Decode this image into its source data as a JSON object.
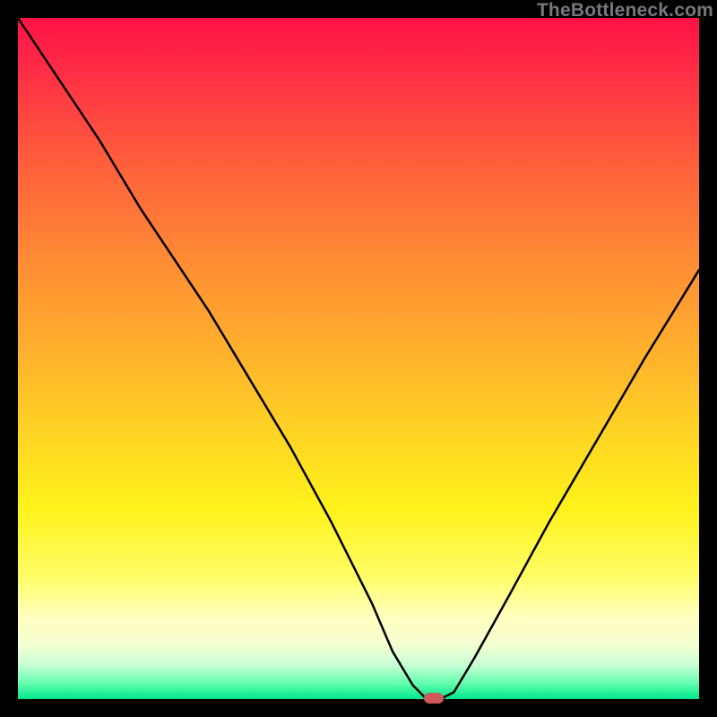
{
  "branding": {
    "watermark": "TheBottleneck.com"
  },
  "colors": {
    "background": "#000000",
    "curve": "#000000",
    "marker": "#d05a5a",
    "gradient_top": "#ff1146",
    "gradient_bottom": "#00e78a"
  },
  "chart_data": {
    "type": "line",
    "title": "",
    "xlabel": "",
    "ylabel": "",
    "xlim": [
      0,
      100
    ],
    "ylim": [
      0,
      100
    ],
    "grid": false,
    "legend": false,
    "note": "Axis values estimated from pixel positions; no tick labels are visible in the image. y≈0 is the bottom (green) edge, y≈100 is the top (red) edge.",
    "series": [
      {
        "name": "bottleneck-curve",
        "x": [
          0,
          6,
          12,
          18,
          24,
          28,
          34,
          40,
          46,
          52,
          55,
          58,
          60,
          62,
          64,
          67,
          72,
          78,
          85,
          92,
          100
        ],
        "values": [
          100,
          91,
          82,
          72,
          63,
          57,
          47,
          37,
          26,
          14,
          7,
          2,
          0,
          0,
          1,
          6,
          15,
          26,
          38,
          50,
          63
        ]
      }
    ],
    "annotations": [
      {
        "name": "optimal-marker",
        "x": 61,
        "y": 0
      }
    ]
  }
}
